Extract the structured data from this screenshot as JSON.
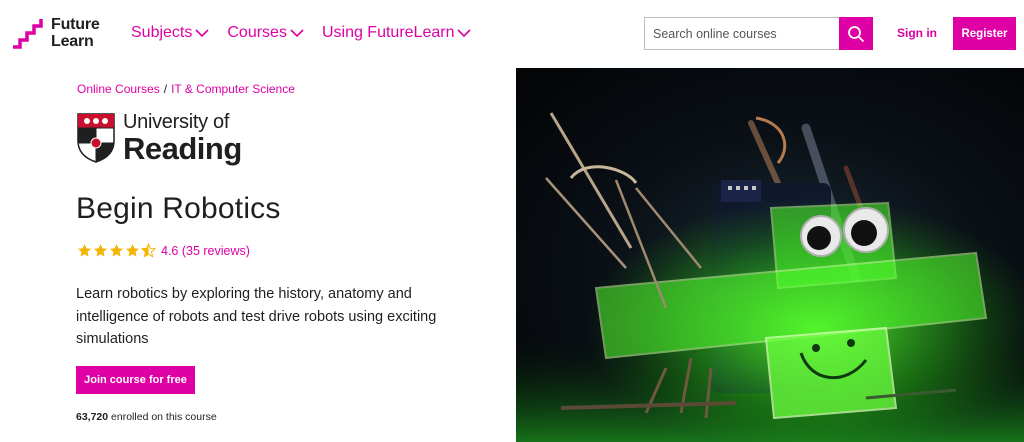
{
  "header": {
    "logo_line1": "Future",
    "logo_line2": "Learn",
    "nav": [
      "Subjects",
      "Courses",
      "Using FutureLearn"
    ],
    "search_placeholder": "Search online courses",
    "signin": "Sign in",
    "register": "Register"
  },
  "breadcrumb": {
    "item1": "Online Courses",
    "separator": "/",
    "item2": "IT & Computer Science"
  },
  "university": {
    "line1": "University of",
    "line2": "Reading"
  },
  "course": {
    "title": "Begin Robotics",
    "rating_value": 4.6,
    "rating_text": "4.6 (35 reviews)",
    "description": "Learn robotics by exploring the history, anatomy and intelligence of robots and test drive robots using exciting simulations",
    "join_label": "Join course for free",
    "enrolled_count": "63,720",
    "enrolled_suffix": " enrolled on this course"
  },
  "colors": {
    "brand": "#de00a5",
    "star": "#f4b400",
    "text": "#1f1f1f"
  },
  "icons": [
    "futurelearn-logo-icon",
    "chevron-down-icon",
    "search-icon",
    "star-icon",
    "university-crest-icon"
  ]
}
